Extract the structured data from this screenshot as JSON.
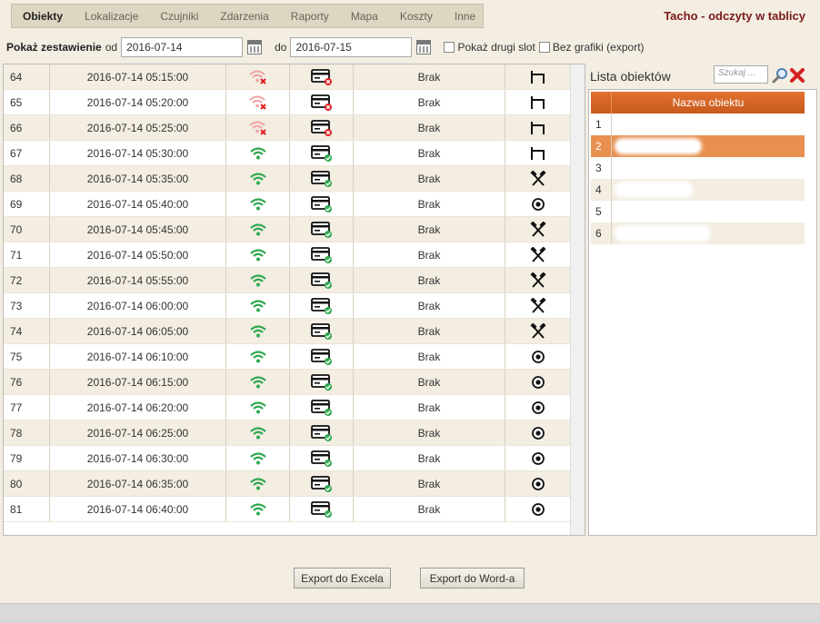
{
  "nav": {
    "items": [
      "Obiekty",
      "Lokalizacje",
      "Czujniki",
      "Zdarzenia",
      "Raporty",
      "Mapa",
      "Koszty",
      "Inne"
    ],
    "active_index": 0
  },
  "app_title": "Tacho - odczyty w tablicy",
  "filters": {
    "label_bold": "Pokaż zestawienie",
    "label_from": "od",
    "date_from": "2016-07-14",
    "label_to": "do",
    "date_to": "2016-07-15",
    "checkbox_second_slot": "Pokaż drugi slot",
    "checkbox_no_graphics": "Bez grafiki (export)"
  },
  "table": {
    "rows": [
      {
        "num": "64",
        "datetime": "2016-07-14 05:15:00",
        "signal": "wifi-off-icon",
        "card": "card-error-icon",
        "status": "Brak",
        "activity": "bed-icon"
      },
      {
        "num": "65",
        "datetime": "2016-07-14 05:20:00",
        "signal": "wifi-off-icon",
        "card": "card-error-icon",
        "status": "Brak",
        "activity": "bed-icon"
      },
      {
        "num": "66",
        "datetime": "2016-07-14 05:25:00",
        "signal": "wifi-off-icon",
        "card": "card-error-icon",
        "status": "Brak",
        "activity": "bed-icon"
      },
      {
        "num": "67",
        "datetime": "2016-07-14 05:30:00",
        "signal": "wifi-on-icon",
        "card": "card-ok-icon",
        "status": "Brak",
        "activity": "bed-icon"
      },
      {
        "num": "68",
        "datetime": "2016-07-14 05:35:00",
        "signal": "wifi-on-icon",
        "card": "card-ok-icon",
        "status": "Brak",
        "activity": "hammers-icon"
      },
      {
        "num": "69",
        "datetime": "2016-07-14 05:40:00",
        "signal": "wifi-on-icon",
        "card": "card-ok-icon",
        "status": "Brak",
        "activity": "circle-dot-icon"
      },
      {
        "num": "70",
        "datetime": "2016-07-14 05:45:00",
        "signal": "wifi-on-icon",
        "card": "card-ok-icon",
        "status": "Brak",
        "activity": "hammers-icon"
      },
      {
        "num": "71",
        "datetime": "2016-07-14 05:50:00",
        "signal": "wifi-on-icon",
        "card": "card-ok-icon",
        "status": "Brak",
        "activity": "hammers-icon"
      },
      {
        "num": "72",
        "datetime": "2016-07-14 05:55:00",
        "signal": "wifi-on-icon",
        "card": "card-ok-icon",
        "status": "Brak",
        "activity": "hammers-icon"
      },
      {
        "num": "73",
        "datetime": "2016-07-14 06:00:00",
        "signal": "wifi-on-icon",
        "card": "card-ok-icon",
        "status": "Brak",
        "activity": "hammers-icon"
      },
      {
        "num": "74",
        "datetime": "2016-07-14 06:05:00",
        "signal": "wifi-on-icon",
        "card": "card-ok-icon",
        "status": "Brak",
        "activity": "hammers-icon"
      },
      {
        "num": "75",
        "datetime": "2016-07-14 06:10:00",
        "signal": "wifi-on-icon",
        "card": "card-ok-icon",
        "status": "Brak",
        "activity": "circle-dot-icon"
      },
      {
        "num": "76",
        "datetime": "2016-07-14 06:15:00",
        "signal": "wifi-on-icon",
        "card": "card-ok-icon",
        "status": "Brak",
        "activity": "circle-dot-icon"
      },
      {
        "num": "77",
        "datetime": "2016-07-14 06:20:00",
        "signal": "wifi-on-icon",
        "card": "card-ok-icon",
        "status": "Brak",
        "activity": "circle-dot-icon"
      },
      {
        "num": "78",
        "datetime": "2016-07-14 06:25:00",
        "signal": "wifi-on-icon",
        "card": "card-ok-icon",
        "status": "Brak",
        "activity": "circle-dot-icon"
      },
      {
        "num": "79",
        "datetime": "2016-07-14 06:30:00",
        "signal": "wifi-on-icon",
        "card": "card-ok-icon",
        "status": "Brak",
        "activity": "circle-dot-icon"
      },
      {
        "num": "80",
        "datetime": "2016-07-14 06:35:00",
        "signal": "wifi-on-icon",
        "card": "card-ok-icon",
        "status": "Brak",
        "activity": "circle-dot-icon"
      },
      {
        "num": "81",
        "datetime": "2016-07-14 06:40:00",
        "signal": "wifi-on-icon",
        "card": "card-ok-icon",
        "status": "Brak",
        "activity": "circle-dot-icon"
      }
    ]
  },
  "objects_panel": {
    "title": "Lista obiektów",
    "search_placeholder": "Szukaj ...",
    "column_header": "Nazwa obiektu",
    "rows": [
      {
        "num": "1",
        "selected": false
      },
      {
        "num": "2",
        "selected": true
      },
      {
        "num": "3",
        "selected": false
      },
      {
        "num": "4",
        "selected": false
      },
      {
        "num": "5",
        "selected": false
      },
      {
        "num": "6",
        "selected": false
      }
    ]
  },
  "buttons": {
    "export_excel": "Export do Excela",
    "export_word": "Export do Word-a"
  },
  "colors": {
    "accent_orange": "#d9642a",
    "title_red": "#7a1a1a",
    "wifi_ok": "#2fa84f",
    "wifi_off": "#e04040"
  }
}
